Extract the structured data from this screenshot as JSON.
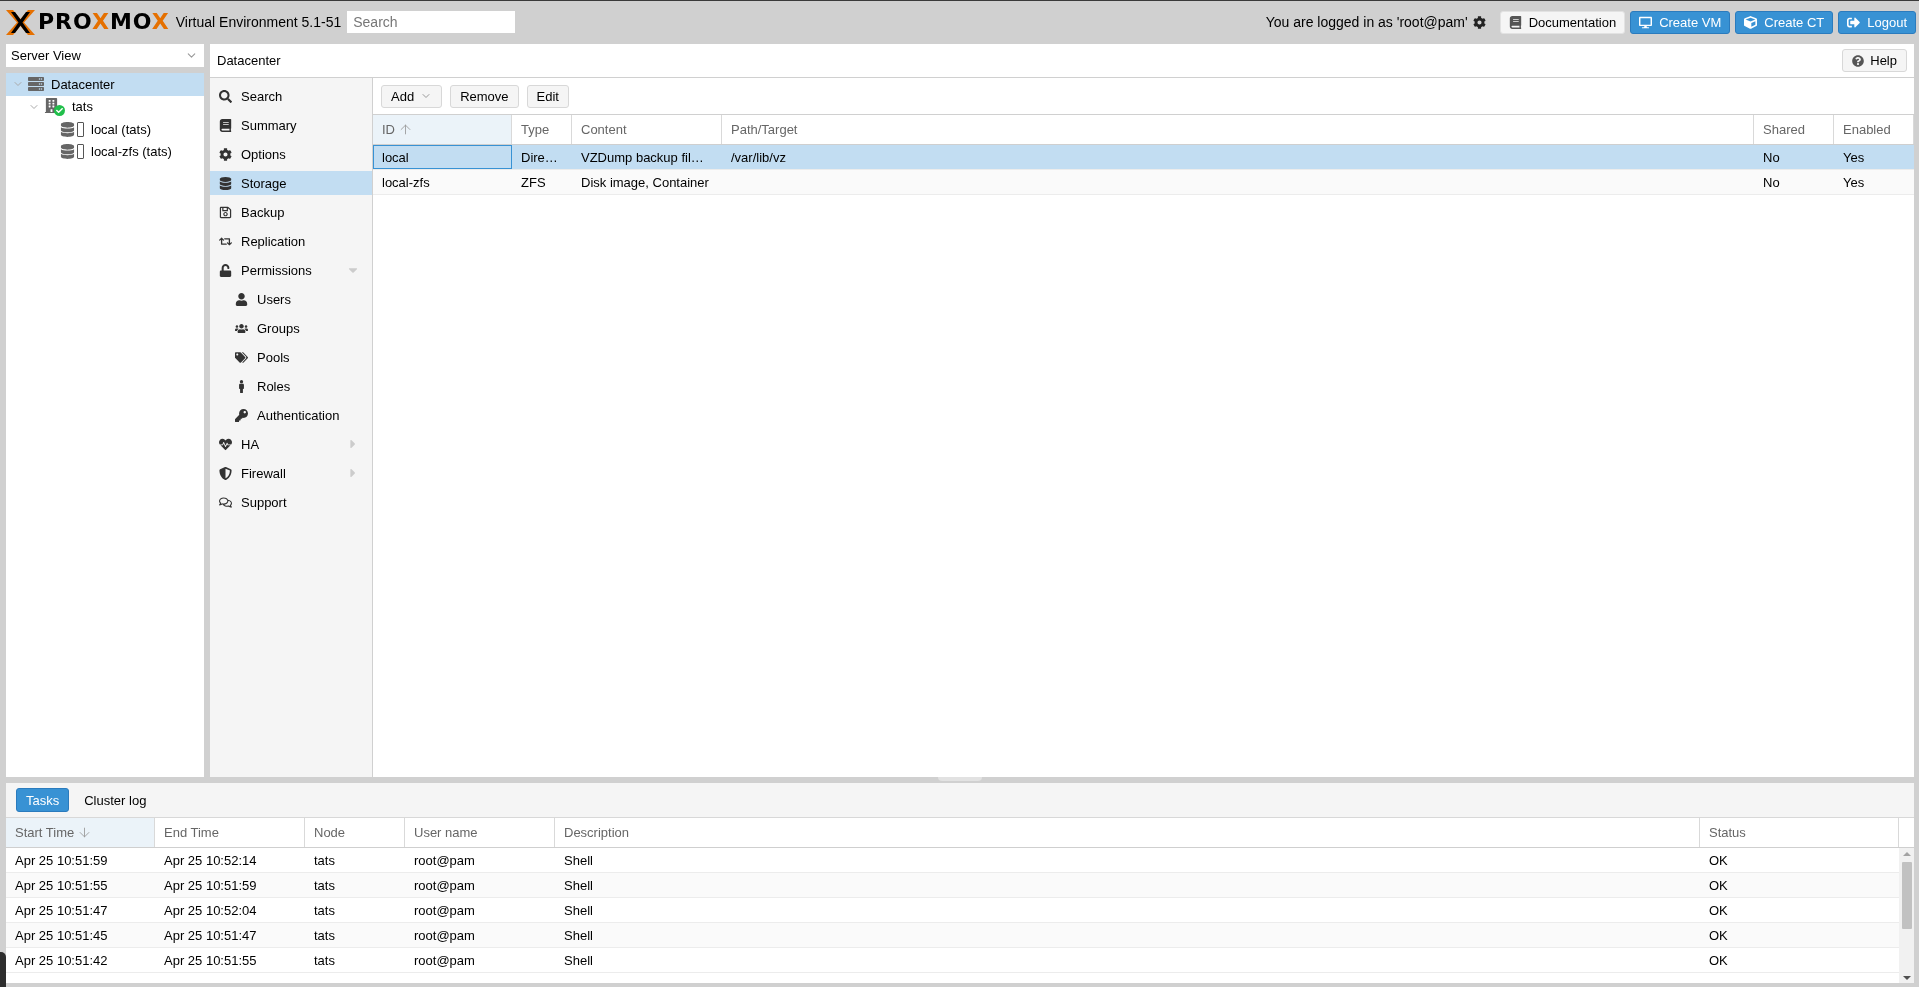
{
  "top_bar": {
    "logo": [
      {
        "text": "PRO",
        "accent": false
      },
      {
        "text": "X",
        "accent": true
      },
      {
        "text": "MO",
        "accent": false
      },
      {
        "text": "X",
        "accent": true
      }
    ],
    "version": "Virtual Environment 5.1-51",
    "search": {
      "placeholder": "Search"
    },
    "login_text": "You are logged in as 'root@pam'",
    "buttons": [
      {
        "label": "Documentation",
        "kind": "plain"
      },
      {
        "label": "Create VM",
        "kind": "primary"
      },
      {
        "label": "Create CT",
        "kind": "primary"
      },
      {
        "label": "Logout",
        "kind": "primary"
      }
    ]
  },
  "resource_tree": {
    "view": "Server View",
    "items": [
      {
        "label": "Datacenter",
        "selected": true,
        "expanded": true,
        "children": [
          {
            "label": "tats",
            "selected": false,
            "expanded": true,
            "children": [
              {
                "label": "local (tats)",
                "selected": false
              },
              {
                "label": "local-zfs (tats)",
                "selected": false
              }
            ]
          }
        ]
      }
    ]
  },
  "content": {
    "title": "Datacenter",
    "help_button": "Help",
    "nav": [
      {
        "label": "Search",
        "selected": false
      },
      {
        "label": "Summary",
        "selected": false
      },
      {
        "label": "Options",
        "selected": false
      },
      {
        "label": "Storage",
        "selected": true
      },
      {
        "label": "Backup",
        "selected": false
      },
      {
        "label": "Replication",
        "selected": false
      },
      {
        "label": "Permissions",
        "selected": false,
        "expanded": true,
        "children": [
          {
            "label": "Users",
            "selected": false
          },
          {
            "label": "Groups",
            "selected": false
          },
          {
            "label": "Pools",
            "selected": false
          },
          {
            "label": "Roles",
            "selected": false
          },
          {
            "label": "Authentication",
            "selected": false
          }
        ]
      },
      {
        "label": "HA",
        "selected": false,
        "expanded": false
      },
      {
        "label": "Firewall",
        "selected": false,
        "expanded": false
      },
      {
        "label": "Support",
        "selected": false
      }
    ],
    "toolbar": [
      {
        "label": "Add",
        "kind": "menu"
      },
      {
        "label": "Remove",
        "kind": "plain"
      },
      {
        "label": "Edit",
        "kind": "plain"
      }
    ],
    "storage_table": {
      "sort_descending": false,
      "columns": [
        {
          "label": "ID",
          "sorted": true
        },
        {
          "label": "Type",
          "sorted": false
        },
        {
          "label": "Content",
          "sorted": false
        },
        {
          "label": "Path/Target",
          "sorted": false
        },
        {
          "label": "Shared",
          "sorted": false
        },
        {
          "label": "Enabled",
          "sorted": false
        }
      ],
      "rows": [
        {
          "id": "local",
          "type": "Dire…",
          "content": "VZDump backup fil…",
          "path_target": "/var/lib/vz",
          "shared": "No",
          "enabled": "Yes",
          "selected": true,
          "focused": true
        },
        {
          "id": "local-zfs",
          "type": "ZFS",
          "content": "Disk image, Container",
          "shared": "No",
          "enabled": "Yes",
          "selected": false,
          "focused": false
        }
      ]
    }
  },
  "log_panel": {
    "tabs": [
      {
        "label": "Tasks",
        "selected": true
      },
      {
        "label": "Cluster log",
        "selected": false
      }
    ],
    "tasks_table": {
      "sort_descending": true,
      "columns": [
        {
          "label": "Start Time",
          "sorted": true
        },
        {
          "label": "End Time",
          "sorted": false
        },
        {
          "label": "Node",
          "sorted": false
        },
        {
          "label": "User name",
          "sorted": false
        },
        {
          "label": "Description",
          "sorted": false
        },
        {
          "label": "Status",
          "sorted": false
        }
      ],
      "rows": [
        {
          "start_time": "Apr 25 10:51:59",
          "end_time": "Apr 25 10:52:14",
          "node": "tats",
          "user_name": "root@pam",
          "description": "Shell",
          "status": "OK"
        },
        {
          "start_time": "Apr 25 10:51:55",
          "end_time": "Apr 25 10:51:59",
          "node": "tats",
          "user_name": "root@pam",
          "description": "Shell",
          "status": "OK"
        },
        {
          "start_time": "Apr 25 10:51:47",
          "end_time": "Apr 25 10:52:04",
          "node": "tats",
          "user_name": "root@pam",
          "description": "Shell",
          "status": "OK"
        },
        {
          "start_time": "Apr 25 10:51:45",
          "end_time": "Apr 25 10:51:47",
          "node": "tats",
          "user_name": "root@pam",
          "description": "Shell",
          "status": "OK"
        },
        {
          "start_time": "Apr 25 10:51:42",
          "end_time": "Apr 25 10:51:55",
          "node": "tats",
          "user_name": "root@pam",
          "description": "Shell",
          "status": "OK"
        }
      ]
    }
  }
}
